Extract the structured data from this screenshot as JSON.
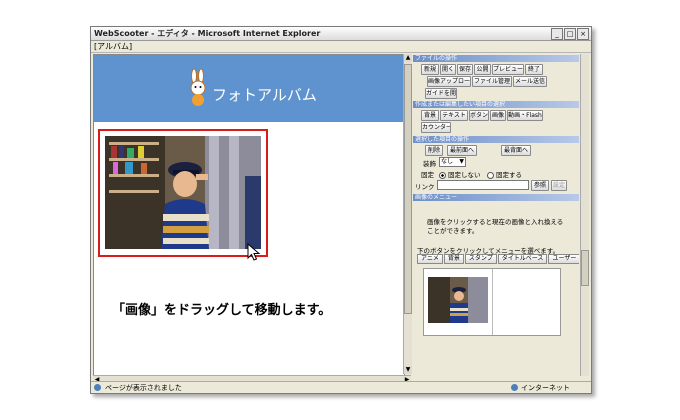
{
  "window": {
    "title": "WebScooter - エディタ - Microsoft Internet Explorer",
    "buttons": [
      "_",
      "□",
      "×"
    ]
  },
  "menubar": {
    "label": "[アルバム]"
  },
  "banner": {
    "title": "フォトアルバム"
  },
  "caption": "「画像」をドラッグして移動します。",
  "panel": {
    "file_ops": {
      "header": "ファイルの操作",
      "buttons": [
        "新規",
        "開く",
        "保存",
        "公開",
        "プレビュー",
        "終了",
        "画像アップロード",
        "ファイル管理",
        "メール送信",
        "ガイドを開く"
      ]
    },
    "insert": {
      "header": "作成または編集したい項目の選択",
      "buttons": [
        "背景",
        "テキスト",
        "ボタン",
        "画像",
        "動画・Flash",
        "カウンター"
      ]
    },
    "selected": {
      "header": "選択した項目の操作",
      "buttons": [
        "削除",
        "最前面へ",
        "最背面へ"
      ],
      "decoration_label": "装飾",
      "decoration_value": "なし",
      "fixed_label": "固定",
      "fixed_options": [
        "固定しない",
        "固定する"
      ],
      "link_label": "リンク",
      "link_value": "",
      "ref_button": "参照",
      "set_button": "設定"
    },
    "menu": {
      "header": "画像のメニュー",
      "text1": "画像をクリックすると現在の画像と入れ換える",
      "text2": "ことができます。",
      "text3": "下のボタンをクリックしてメニューを選べます。",
      "tabs": [
        "アニメ",
        "背景",
        "スタンプ",
        "タイトルベース",
        "ユーザー"
      ]
    }
  },
  "status": {
    "left": "ページが表示されました",
    "right": "インターネット"
  }
}
